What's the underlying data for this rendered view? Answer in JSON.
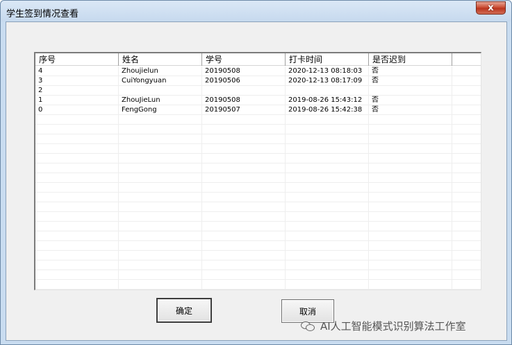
{
  "window": {
    "title": "学生签到情况查看",
    "close_glyph": "x"
  },
  "table": {
    "columns": [
      "序号",
      "姓名",
      "学号",
      "打卡时间",
      "是否迟到"
    ],
    "rows": [
      [
        "4",
        "Zhoujielun",
        "20190508",
        "2020-12-13 08:18:03",
        "否"
      ],
      [
        "3",
        "CuiYongyuan",
        "20190506",
        "2020-12-13 08:17:09",
        "否"
      ],
      [
        "2",
        "",
        "",
        "",
        ""
      ],
      [
        "1",
        "ZhouJieLun",
        "20190508",
        "2019-08-26 15:43:12",
        "否"
      ],
      [
        "0",
        "FengGong",
        "20190507",
        "2019-08-26 15:42:38",
        "否"
      ]
    ]
  },
  "buttons": {
    "ok_label": "确定",
    "cancel_label": "取消"
  },
  "watermark": {
    "text": "AI人工智能模式识别算法工作室",
    "icon": "wechat-icon"
  }
}
